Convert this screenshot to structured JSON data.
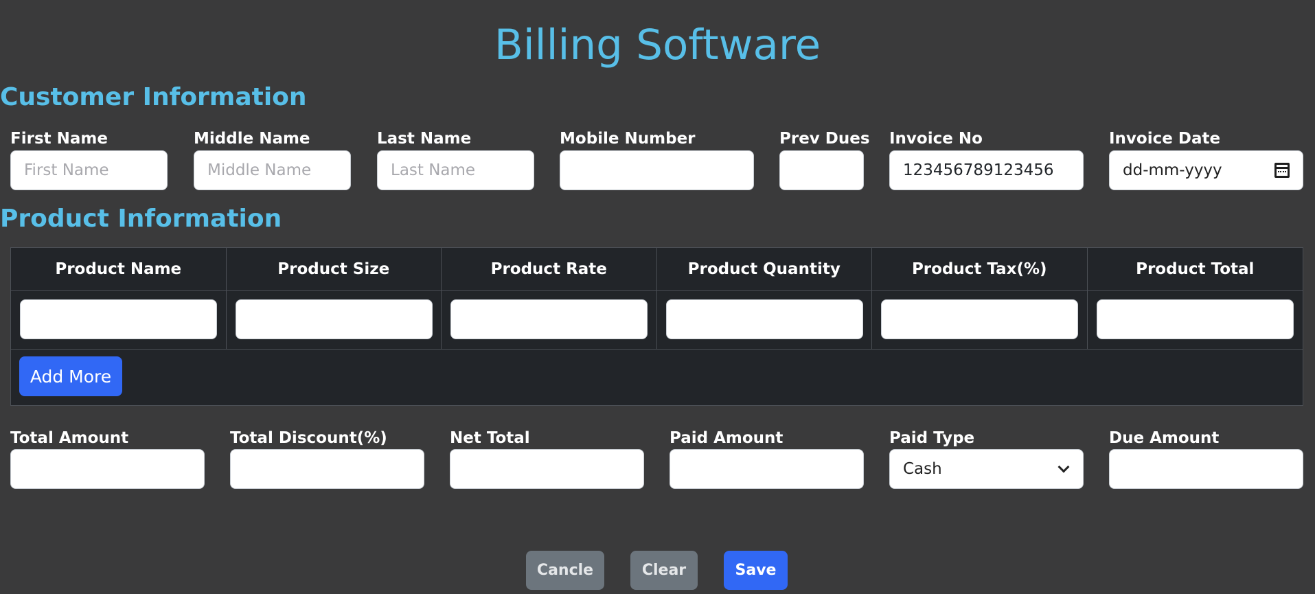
{
  "app": {
    "title": "Billing Software"
  },
  "customer": {
    "heading": "Customer Information",
    "fields": {
      "first_name": {
        "label": "First Name",
        "placeholder": "First Name",
        "value": ""
      },
      "middle_name": {
        "label": "Middle Name",
        "placeholder": "Middle Name",
        "value": ""
      },
      "last_name": {
        "label": "Last Name",
        "placeholder": "Last Name",
        "value": ""
      },
      "mobile_number": {
        "label": "Mobile Number",
        "placeholder": "",
        "value": ""
      },
      "prev_dues": {
        "label": "Prev Dues",
        "placeholder": "",
        "value": ""
      },
      "invoice_no": {
        "label": "Invoice No",
        "placeholder": "",
        "value": "123456789123456"
      },
      "invoice_date": {
        "label": "Invoice Date",
        "value": "dd-mm-yyyy"
      }
    }
  },
  "product": {
    "heading": "Product Information",
    "columns": [
      "Product Name",
      "Product Size",
      "Product Rate",
      "Product Quantity",
      "Product Tax(%)",
      "Product Total"
    ],
    "rows": [
      [
        "",
        "",
        "",
        "",
        "",
        ""
      ]
    ],
    "add_more_label": "Add More"
  },
  "summary": {
    "total_amount": {
      "label": "Total Amount",
      "value": ""
    },
    "total_discount": {
      "label": "Total Discount(%)",
      "value": ""
    },
    "net_total": {
      "label": "Net Total",
      "value": ""
    },
    "paid_amount": {
      "label": "Paid Amount",
      "value": ""
    },
    "paid_type": {
      "label": "Paid Type",
      "value": "Cash"
    },
    "due_amount": {
      "label": "Due Amount",
      "value": ""
    }
  },
  "actions": {
    "cancel_label": "Cancle",
    "clear_label": "Clear",
    "save_label": "Save"
  },
  "colors": {
    "background": "#3a3a3b",
    "heading": "#58bfe8",
    "primary": "#3168f5",
    "secondary": "#6c757d"
  }
}
